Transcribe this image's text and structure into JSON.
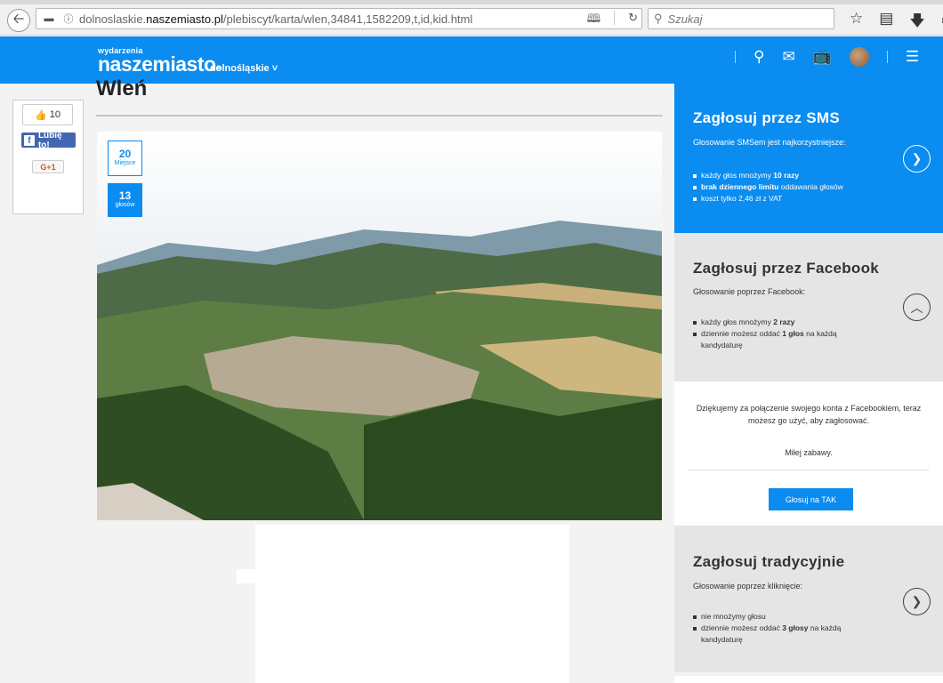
{
  "browser": {
    "url_prefix": "dolnoslaskie.",
    "url_domain": "naszemiasto.pl",
    "url_path": "/plebiscyt/karta/wlen,34841,1582209,t,id,kid.html",
    "search_placeholder": "Szukaj"
  },
  "header": {
    "logo_small": "wydarzenia",
    "logo_big": "naszemiasto",
    "logo_reg": "®",
    "region": "dolnośląskie ˅"
  },
  "social": {
    "like_count": "10",
    "fb_label": "Lubię to!",
    "gplus_label": "G+1"
  },
  "main": {
    "title": "Wleń",
    "rank_value": "20",
    "rank_label": "Miejsce",
    "votes_value": "13",
    "votes_label": "głosów"
  },
  "sidebar": {
    "sms": {
      "title": "Zagłosuj przez SMS",
      "subtitle": "Głosowanie SMSem jest najkorzystniejsze:",
      "item1_pre": "każdy głos mnożymy ",
      "item1_bold": "10 razy",
      "item2_bold": "brak dziennego limitu",
      "item2_post": " oddawania głosów",
      "item3": "koszt tylko 2,46 zł z VAT"
    },
    "facebook": {
      "title": "Zagłosuj przez Facebook",
      "subtitle": "Głosowanie poprzez Facebook:",
      "item1_pre": "każdy głos mnożymy ",
      "item1_bold": "2 razy",
      "item2_pre": "dziennie możesz oddać ",
      "item2_bold": "1 głos",
      "item2_post": " na każdą kandydaturę",
      "card_text": "Dziękujemy za połączenie swojego konta z Facebookiem, teraz możesz go użyć, aby zagłosować.",
      "card_thanks": "Miłej zabawy.",
      "vote_button": "Głosuj na TAK"
    },
    "traditional": {
      "title": "Zagłosuj tradycyjnie",
      "subtitle": "Głosowanie poprzez kliknięcie:",
      "item1": "nie mnożymy głosu",
      "item2_pre": "dziennie możesz oddać ",
      "item2_bold": "3 głosy",
      "item2_post": " na każdą kandydaturę"
    }
  },
  "colors": {
    "brand_blue": "#0a8cf0",
    "facebook_blue": "#4267b2",
    "sidebar_gray": "#e5e5e5"
  },
  "icons": [
    "back-arrow-icon",
    "info-icon",
    "reader-view-icon",
    "reload-icon",
    "search-icon",
    "star-icon",
    "bookmarks-icon",
    "download-icon",
    "home-icon",
    "mail-icon",
    "tv-icon",
    "menu-icon",
    "thumbs-up-icon",
    "facebook-icon",
    "chevron-right-icon",
    "chevron-up-icon"
  ]
}
